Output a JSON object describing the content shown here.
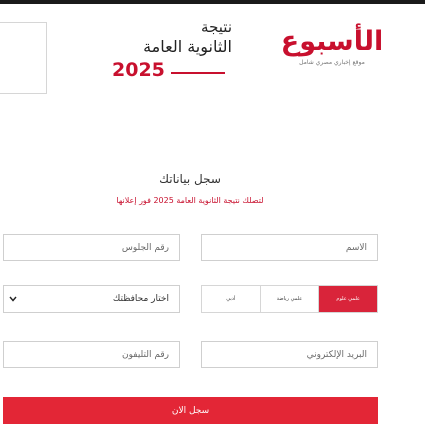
{
  "header": {
    "logo_text": "الأسبوع",
    "logo_tagline": "موقع إخباري مصري شامل",
    "result_line1": "نتيجة",
    "result_line2": "الثانوية العامة",
    "result_year": "2025"
  },
  "form": {
    "heading": "سجل بياناتك",
    "subheading": "لتصلك نتيجة الثانوية العامة 2025 فور إعلانها",
    "name_placeholder": "الأسم",
    "seat_placeholder": "رقم الجلوس",
    "tracks": [
      "علمي علوم",
      "علمي رياضة",
      "أدبي"
    ],
    "active_track_index": 0,
    "governorate_selected": "اختار محافظتك",
    "email_placeholder": "البريد الإلكتروني",
    "phone_placeholder": "رقم التليفون",
    "submit_label": "سجل الان"
  },
  "icons": {
    "select_chevron": "chevron-down-icon"
  },
  "colors": {
    "brand_red": "#c8102e",
    "button_red": "#e32636",
    "active_track": "#d9243a"
  }
}
